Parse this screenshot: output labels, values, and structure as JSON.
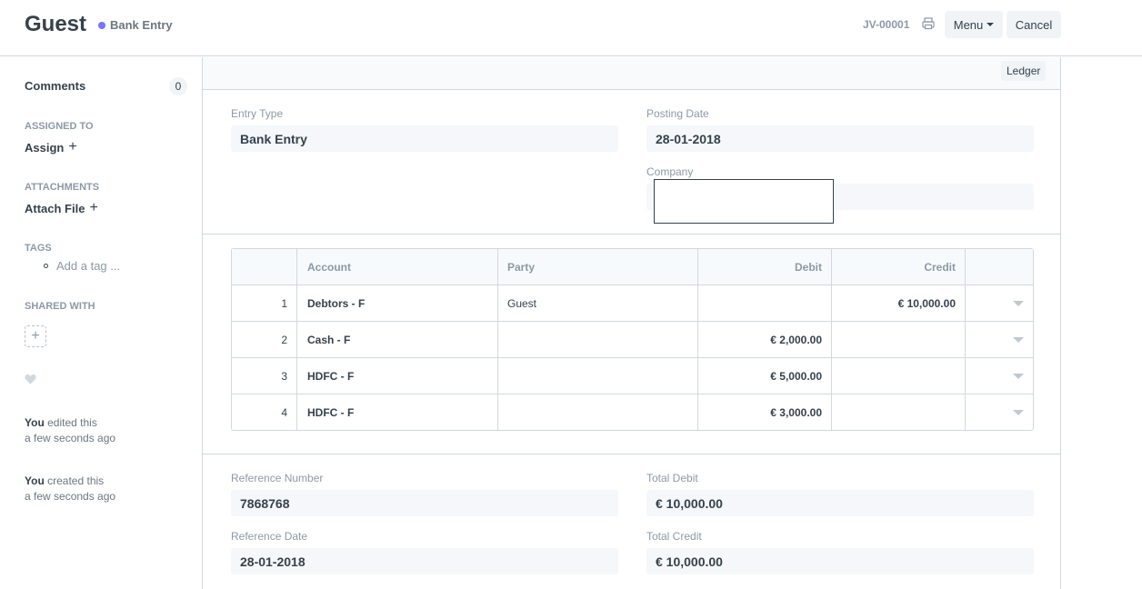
{
  "header": {
    "title": "Guest",
    "status": "Bank Entry",
    "doc_name": "JV-00001",
    "menu_label": "Menu",
    "cancel_label": "Cancel"
  },
  "sidebar": {
    "comments_label": "Comments",
    "comments_count": "0",
    "assigned_to_label": "ASSIGNED TO",
    "assign_label": "Assign",
    "attachments_label": "ATTACHMENTS",
    "attach_file_label": "Attach File",
    "tags_label": "TAGS",
    "add_tag_label": "Add a tag ...",
    "shared_with_label": "SHARED WITH",
    "activity": [
      {
        "user": "You",
        "action": "edited this",
        "time": "a few seconds ago"
      },
      {
        "user": "You",
        "action": "created this",
        "time": "a few seconds ago"
      }
    ]
  },
  "toolbar": {
    "ledger_label": "Ledger"
  },
  "form": {
    "entry_type_label": "Entry Type",
    "entry_type_value": "Bank Entry",
    "posting_date_label": "Posting Date",
    "posting_date_value": "28-01-2018",
    "company_label": "Company",
    "company_value": "",
    "reference_number_label": "Reference Number",
    "reference_number_value": "7868768",
    "total_debit_label": "Total Debit",
    "total_debit_value": "€ 10,000.00",
    "reference_date_label": "Reference Date",
    "reference_date_value": "28-01-2018",
    "total_credit_label": "Total Credit",
    "total_credit_value": "€ 10,000.00"
  },
  "accounts_table": {
    "columns": [
      "",
      "Account",
      "Party",
      "Debit",
      "Credit",
      ""
    ],
    "rows": [
      {
        "idx": "1",
        "account": "Debtors - F",
        "party": "Guest",
        "debit": "",
        "credit": "€ 10,000.00"
      },
      {
        "idx": "2",
        "account": "Cash - F",
        "party": "",
        "debit": "€ 2,000.00",
        "credit": ""
      },
      {
        "idx": "3",
        "account": "HDFC - F",
        "party": "",
        "debit": "€ 5,000.00",
        "credit": ""
      },
      {
        "idx": "4",
        "account": "HDFC - F",
        "party": "",
        "debit": "€ 3,000.00",
        "credit": ""
      }
    ]
  },
  "colors": {
    "status_dot": "#7575ff",
    "border": "#d1d8dd",
    "text": "#36414c",
    "muted": "#8d99a6"
  },
  "icons": {
    "print": "printer-icon",
    "caret": "chevron-down-icon",
    "plus": "plus-icon",
    "heart": "heart-icon"
  }
}
